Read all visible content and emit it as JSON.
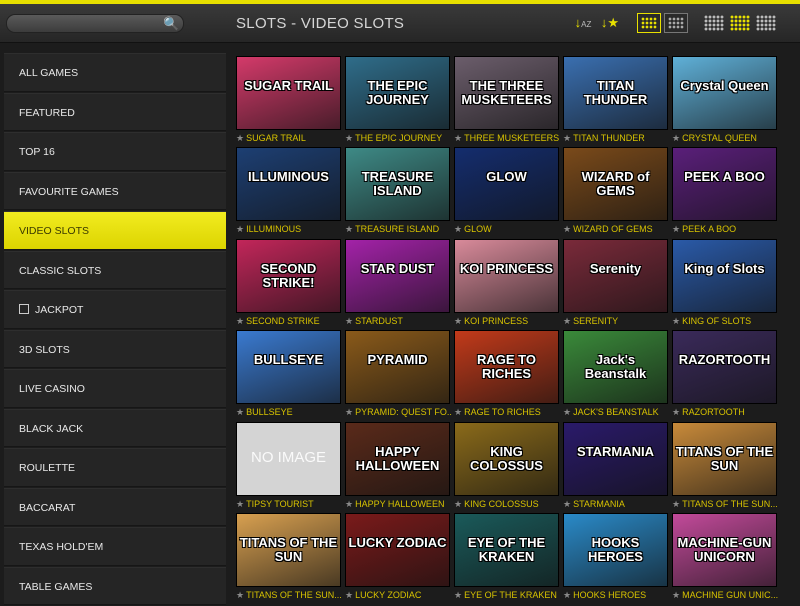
{
  "header": {
    "title": "SLOTS - VIDEO SLOTS",
    "search_placeholder": ""
  },
  "sidebar": {
    "items": [
      {
        "label": "ALL GAMES"
      },
      {
        "label": "FEATURED"
      },
      {
        "label": "TOP 16"
      },
      {
        "label": "FAVOURITE GAMES"
      },
      {
        "label": "VIDEO SLOTS",
        "active": true
      },
      {
        "label": "CLASSIC SLOTS"
      },
      {
        "label": "JACKPOT"
      },
      {
        "label": "3D SLOTS"
      },
      {
        "label": "LIVE CASINO"
      },
      {
        "label": "BLACK JACK"
      },
      {
        "label": "ROULETTE"
      },
      {
        "label": "BACCARAT"
      },
      {
        "label": "TEXAS HOLD'EM"
      },
      {
        "label": "TABLE GAMES"
      }
    ]
  },
  "games": [
    {
      "name": "SUGAR TRAIL",
      "art": "SUGAR TRAIL",
      "color": "#d43a6a"
    },
    {
      "name": "THE EPIC JOURNEY",
      "art": "THE EPIC JOURNEY",
      "color": "#2f6d8a"
    },
    {
      "name": "THREE MUSKETEERS",
      "art": "THE THREE MUSKETEERS",
      "color": "#6b5d6b"
    },
    {
      "name": "TITAN THUNDER",
      "art": "TITAN THUNDER",
      "color": "#3a6fb0"
    },
    {
      "name": "CRYSTAL QUEEN",
      "art": "Crystal Queen",
      "color": "#5fb0d8"
    },
    {
      "name": "ILLUMINOUS",
      "art": "ILLUMINOUS",
      "color": "#1d3f73"
    },
    {
      "name": "TREASURE ISLAND",
      "art": "TREASURE ISLAND",
      "color": "#3e8a86"
    },
    {
      "name": "GLOW",
      "art": "GLOW",
      "color": "#142d6e"
    },
    {
      "name": "WIZARD OF GEMS",
      "art": "WIZARD of GEMS",
      "color": "#7a4a1a"
    },
    {
      "name": "PEEK A BOO",
      "art": "PEEK A BOO",
      "color": "#5a1f7a"
    },
    {
      "name": "SECOND STRIKE",
      "art": "SECOND STRIKE!",
      "color": "#c2265a"
    },
    {
      "name": "STARDUST",
      "art": "STAR DUST",
      "color": "#a322a8"
    },
    {
      "name": "KOI PRINCESS",
      "art": "KOI PRINCESS",
      "color": "#d88a9a"
    },
    {
      "name": "SERENITY",
      "art": "Serenity",
      "color": "#7a2a3a"
    },
    {
      "name": "KING OF SLOTS",
      "art": "King of Slots",
      "color": "#2a5aa8"
    },
    {
      "name": "BULLSEYE",
      "art": "BULLSEYE",
      "color": "#3a7ad0"
    },
    {
      "name": "PYRAMID: QUEST FO...",
      "art": "PYRAMID",
      "color": "#8a5a1a"
    },
    {
      "name": "RAGE TO RICHES",
      "art": "RAGE TO RICHES",
      "color": "#c23a1a"
    },
    {
      "name": "JACK'S BEANSTALK",
      "art": "Jack's Beanstalk",
      "color": "#3a8a3a"
    },
    {
      "name": "RAZORTOOTH",
      "art": "RAZORTOOTH",
      "color": "#3a2a5a"
    },
    {
      "name": "TIPSY TOURIST",
      "art": "NO IMAGE",
      "color": "#d4d4d4",
      "noimage": true
    },
    {
      "name": "HAPPY HALLOWEEN",
      "art": "HAPPY HALLOWEEN",
      "color": "#5a2a1a"
    },
    {
      "name": "KING COLOSSUS",
      "art": "KING COLOSSUS",
      "color": "#8a6a1a"
    },
    {
      "name": "STARMANIA",
      "art": "STARMANIA",
      "color": "#2a1a6a"
    },
    {
      "name": "TITANS OF THE SUN...",
      "art": "TITANS OF THE SUN",
      "color": "#c88a3a"
    },
    {
      "name": "TITANS OF THE SUN...",
      "art": "TITANS OF THE SUN",
      "color": "#d8a050"
    },
    {
      "name": "LUCKY ZODIAC",
      "art": "LUCKY ZODIAC",
      "color": "#7a1a1a"
    },
    {
      "name": "EYE OF THE KRAKEN",
      "art": "EYE OF THE KRAKEN",
      "color": "#1a5a5a"
    },
    {
      "name": "HOOKS HEROES",
      "art": "HOOKS HEROES",
      "color": "#2a8ac8"
    },
    {
      "name": "MACHINE GUN UNIC...",
      "art": "MACHINE-GUN UNICORN",
      "color": "#c24a9a"
    }
  ],
  "colors": {
    "accent": "#e8e000",
    "caption": "#d8c300",
    "background": "#1c1c1c"
  }
}
